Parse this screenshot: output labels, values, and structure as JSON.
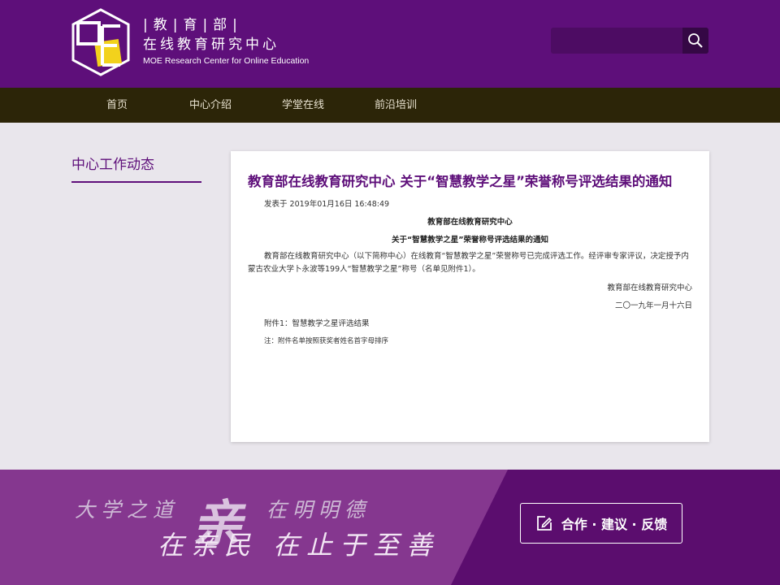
{
  "header": {
    "logo_line1": "|教|育|部|",
    "logo_line2": "在线教育研究中心",
    "logo_line3": "MOE Research Center for Online Education",
    "search_placeholder": "",
    "search_icon": "search-icon"
  },
  "nav": {
    "items": [
      {
        "label": "首页"
      },
      {
        "label": "中心介绍"
      },
      {
        "label": "学堂在线"
      },
      {
        "label": "前沿培训"
      }
    ]
  },
  "sidebar": {
    "title": "中心工作动态"
  },
  "article": {
    "title": "教育部在线教育研究中心 关于“智慧教学之星”荣誉称号评选结果的通知",
    "date": "发表于 2019年01月16日 16:48:49",
    "org": "教育部在线教育研究中心",
    "subtitle": "关于“智慧教学之星”荣誉称号评选结果的通知",
    "body": "教育部在线教育研究中心（以下简称中心）在线教育“智慧教学之星”荣誉称号已完成评选工作。经评审专家评议，决定授予内蒙古农业大学卜永波等199人“智慧教学之星”称号（名单见附件1）。",
    "signature": "教育部在线教育研究中心",
    "sign_date": "二〇一九年一月十六日",
    "attachment": "附件1：智慧教学之星评选结果",
    "note": "注：附件名单按照获奖者姓名首字母排序"
  },
  "footer": {
    "slogan_line1": "大学之道",
    "slogan_big": "亲",
    "slogan_line1b": "在明明德",
    "slogan_line2": "在亲民 在止于至善",
    "feedback_label": "合作 · 建议 · 反馈",
    "feedback_icon": "edit-icon"
  },
  "colors": {
    "brand_purple": "#5e0f7a",
    "nav_bg": "#2c2508",
    "footer_light": "#85378f",
    "footer_dark": "#5b0d6e",
    "logo_yellow": "#f2d21c"
  }
}
